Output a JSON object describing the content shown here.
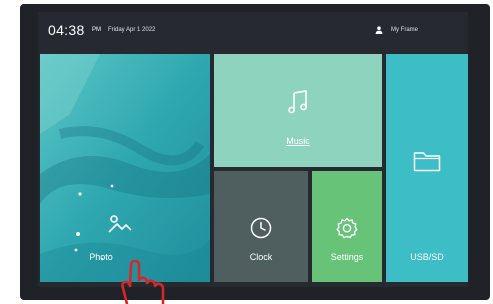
{
  "status_bar": {
    "time": "04:38",
    "ampm": "PM",
    "date": "Friday Apr 1 2022",
    "frame_name": "My Frame"
  },
  "tiles": {
    "photo": "Photo",
    "music": "Music",
    "clock": "Clock",
    "settings": "Settings",
    "usb": "USB/SD"
  },
  "icons": {
    "photo": "image-icon",
    "music": "music-note-icon",
    "clock": "clock-icon",
    "settings": "gear-icon",
    "usb": "folder-icon",
    "user": "user-icon",
    "pointer": "hand-pointer-icon"
  },
  "colors": {
    "screen_bg": "#262a30",
    "photo_sea": "#2eaab2",
    "music_tile": "#8ed3bd",
    "usb_tile": "#3dbdc6",
    "clock_tile": "#4f5e5e",
    "settings_tile": "#66c378",
    "pointer": "#d6262a"
  }
}
